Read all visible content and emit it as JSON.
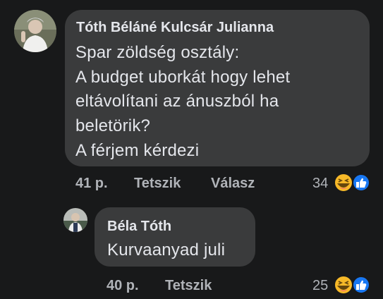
{
  "comments": [
    {
      "author": "Tóth Béláné Kulcsár Julianna",
      "lines": [
        "Spar zöldség osztály:",
        "A budget uborkát hogy lehet",
        "eltávolítani az ánuszból ha",
        "beletörik?",
        "A férjem kérdezi"
      ],
      "time": "41 p.",
      "like_label": "Tetszik",
      "reply_label": "Válasz",
      "reaction_count": "34",
      "reaction_icons": [
        "haha-icon",
        "like-icon"
      ]
    },
    {
      "author": "Béla Tóth",
      "lines": [
        "Kurvaanyad juli"
      ],
      "time": "40 p.",
      "like_label": "Tetszik",
      "reaction_count": "25",
      "reaction_icons": [
        "haha-icon",
        "like-icon"
      ]
    }
  ],
  "colors": {
    "background": "#18191a",
    "bubble": "#3a3b3c",
    "text": "#e4e6eb",
    "secondary": "#b0b3b8",
    "like_blue": "#1877f2",
    "haha_yellow": "#f7b928"
  }
}
